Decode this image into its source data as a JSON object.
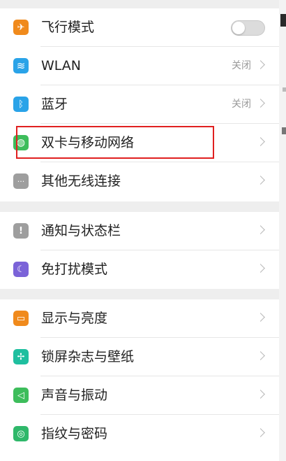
{
  "settings": {
    "airplane": {
      "label": "飞行模式",
      "toggle_on": false
    },
    "wlan": {
      "label": "WLAN",
      "status": "关闭"
    },
    "bluetooth": {
      "label": "蓝牙",
      "status": "关闭"
    },
    "dual_sim": {
      "label": "双卡与移动网络"
    },
    "other_wireless": {
      "label": "其他无线连接"
    },
    "notifications": {
      "label": "通知与状态栏"
    },
    "dnd": {
      "label": "免打扰模式"
    },
    "display": {
      "label": "显示与亮度"
    },
    "lockscreen": {
      "label": "锁屏杂志与壁纸"
    },
    "sound": {
      "label": "声音与振动"
    },
    "fingerprint": {
      "label": "指纹与密码"
    }
  },
  "icons": {
    "airplane": {
      "name": "airplane-icon",
      "color": "#f08a1c",
      "glyph": "✈"
    },
    "wlan": {
      "name": "wifi-icon",
      "color": "#2aa3e8",
      "glyph": "≋"
    },
    "bluetooth": {
      "name": "bluetooth-icon",
      "color": "#2aa3e8",
      "glyph": "ᛒ"
    },
    "dual_sim": {
      "name": "globe-icon",
      "color": "#3dbd5b",
      "glyph": "◍"
    },
    "other_wireless": {
      "name": "more-icon",
      "color": "#9e9e9e",
      "glyph": "···"
    },
    "notifications": {
      "name": "notification-icon",
      "color": "#9e9e9e",
      "glyph": "!"
    },
    "dnd": {
      "name": "moon-icon",
      "color": "#7b63d8",
      "glyph": "☾"
    },
    "display": {
      "name": "display-icon",
      "color": "#f08a1c",
      "glyph": "▭"
    },
    "lockscreen": {
      "name": "pinwheel-icon",
      "color": "#1fbf9f",
      "glyph": "✢"
    },
    "sound": {
      "name": "speaker-icon",
      "color": "#3dbd5b",
      "glyph": "◁"
    },
    "fingerprint": {
      "name": "fingerprint-icon",
      "color": "#2fb86a",
      "glyph": "◎"
    }
  },
  "annotation": {
    "highlight_color": "#e02020"
  }
}
